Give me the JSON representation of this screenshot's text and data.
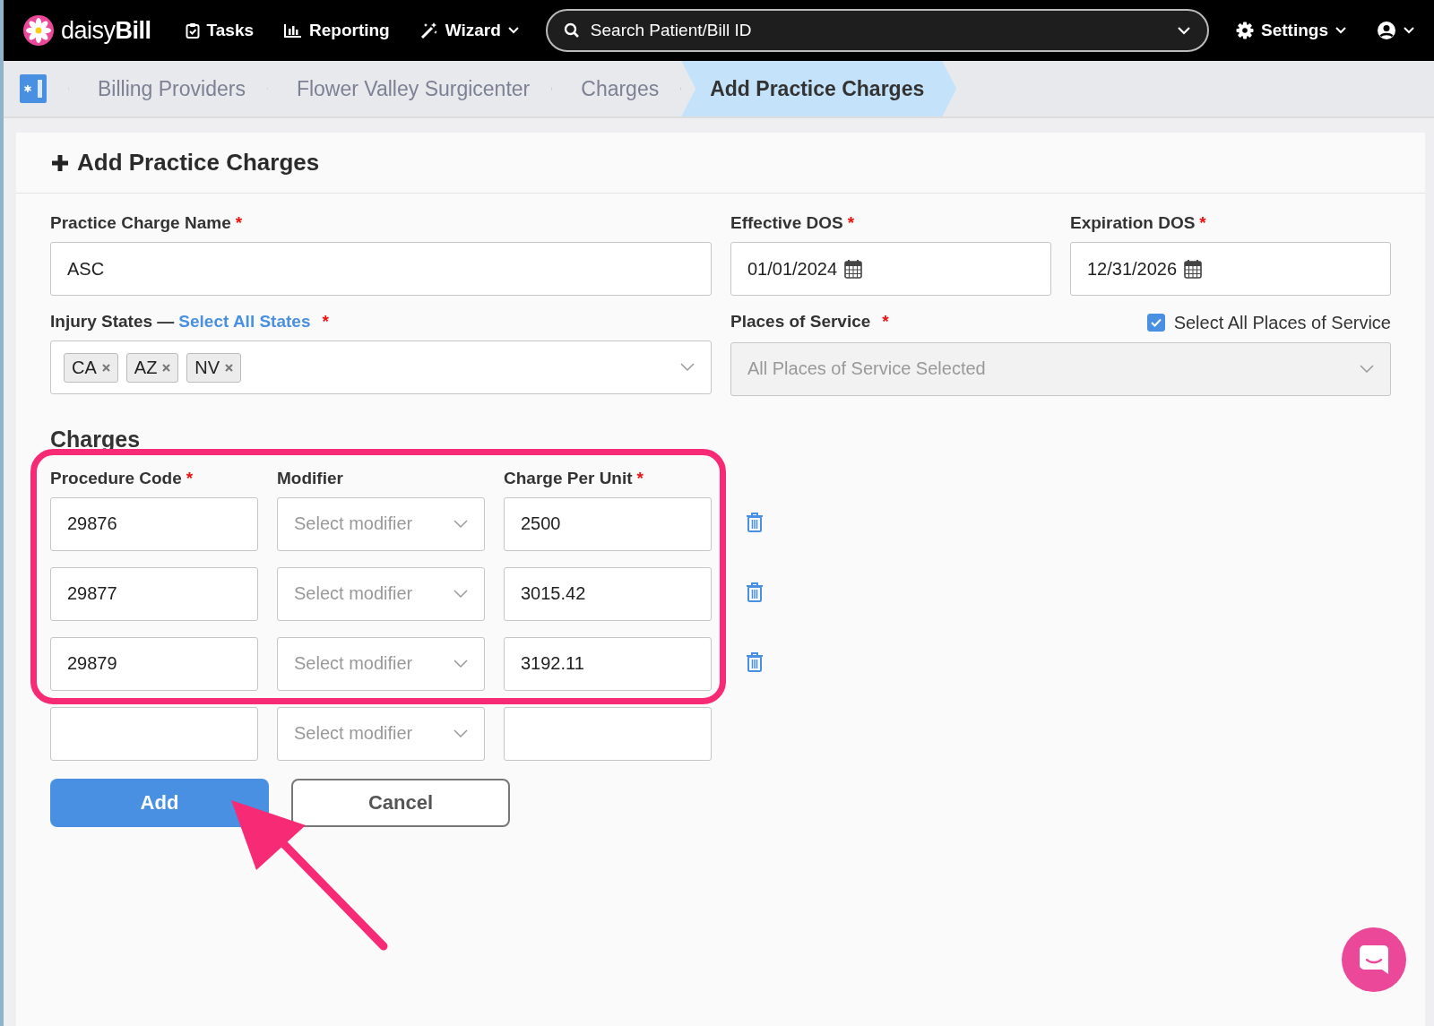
{
  "nav": {
    "logo_prefix": "daisy",
    "logo_suffix": "Bill",
    "items": [
      {
        "label": "Tasks",
        "kind": "tasks",
        "caret": false
      },
      {
        "label": "Reporting",
        "kind": "reporting",
        "caret": false
      },
      {
        "label": "Wizard",
        "kind": "wizard",
        "caret": true
      }
    ],
    "search": {
      "placeholder": "Search Patient/Bill ID"
    },
    "settings": "Settings"
  },
  "breadcrumbs": [
    {
      "label": "Billing Providers",
      "selected": false
    },
    {
      "label": "Flower Valley Surgicenter",
      "selected": false
    },
    {
      "label": "Charges",
      "selected": false
    },
    {
      "label": "Add Practice Charges",
      "selected": true
    }
  ],
  "card": {
    "title": "Add Practice Charges",
    "required_mark": "*",
    "fields": {
      "name": {
        "label": "Practice Charge Name",
        "required": true,
        "value": "ASC"
      },
      "effective": {
        "label": "Effective DOS",
        "required": true,
        "value": "01/01/2024"
      },
      "expiration": {
        "label": "Expiration DOS",
        "required": true,
        "value": "12/31/2026"
      },
      "states": {
        "label": "Injury States —",
        "link": "Select All States",
        "required": true,
        "tags": [
          "CA",
          "AZ",
          "NV"
        ]
      },
      "places": {
        "label": "Places of Service",
        "required": true,
        "checkbox_label": "Select All Places of Service",
        "checked": true,
        "disabled": true,
        "value": "All Places of Service Selected"
      }
    },
    "charges": {
      "title": "Charges",
      "columns": [
        {
          "label": "Procedure Code",
          "required": true
        },
        {
          "label": "Modifier",
          "required": false
        },
        {
          "label": "Charge Per Unit",
          "required": true
        }
      ],
      "rows": [
        {
          "code": "29876",
          "modifier_placeholder": "Select modifier",
          "charge": "2500",
          "removable": true
        },
        {
          "code": "29877",
          "modifier_placeholder": "Select modifier",
          "charge": "3015.42",
          "removable": true
        },
        {
          "code": "29879",
          "modifier_placeholder": "Select modifier",
          "charge": "3192.11",
          "removable": true
        },
        {
          "modifier_placeholder": "Select modifier",
          "removable": false
        }
      ]
    },
    "buttons": [
      {
        "label": "Add",
        "kind": "primary"
      },
      {
        "label": "Cancel",
        "kind": "secondary"
      }
    ]
  }
}
